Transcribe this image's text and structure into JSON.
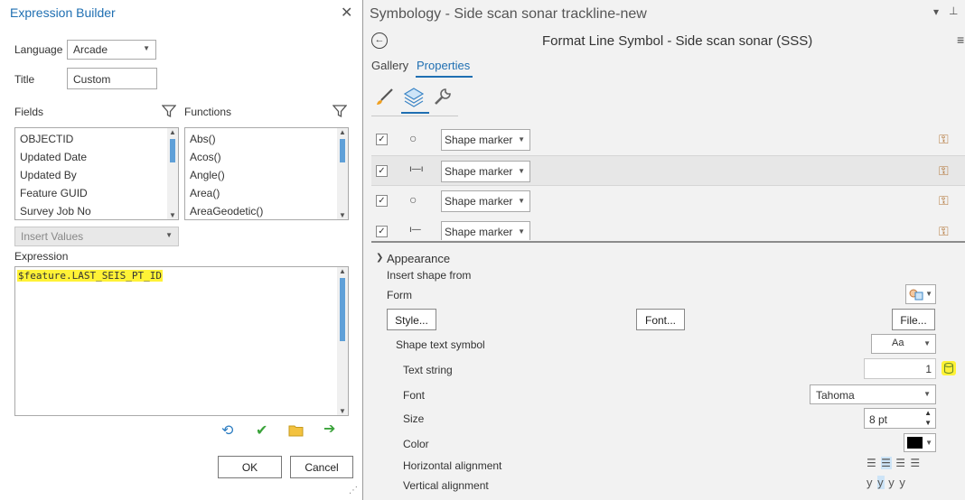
{
  "expression_builder": {
    "title": "Expression Builder",
    "language_label": "Language",
    "language_value": "Arcade",
    "title_label": "Title",
    "title_value": "Custom",
    "fields_label": "Fields",
    "functions_label": "Functions",
    "fields": [
      "OBJECTID",
      "Updated Date",
      "Updated By",
      "Feature GUID",
      "Survey Job No"
    ],
    "functions": [
      "Abs()",
      "Acos()",
      "Angle()",
      "Area()",
      "AreaGeodetic()"
    ],
    "insert_values": "Insert Values",
    "expression_label": "Expression",
    "expression_keyword": "$feature",
    "expression_field": ".LAST_SEIS_PT_ID",
    "ok": "OK",
    "cancel": "Cancel"
  },
  "symbology": {
    "pane_title": "Symbology - Side scan sonar trackline-new",
    "format_title": "Format Line Symbol - Side scan sonar (SSS)",
    "tabs": [
      "Gallery",
      "Properties"
    ],
    "layers": [
      {
        "checked": true,
        "marker": "Shape marker",
        "glyph": "○"
      },
      {
        "checked": true,
        "marker": "Shape marker",
        "glyph": "ı—ı"
      },
      {
        "checked": true,
        "marker": "Shape marker",
        "glyph": "○"
      },
      {
        "checked": true,
        "marker": "Shape marker",
        "glyph": "ı—"
      }
    ],
    "appearance": {
      "heading": "Appearance",
      "insert_shape_from": "Insert shape from",
      "form": "Form",
      "style_btn": "Style...",
      "font_btn": "Font...",
      "file_btn": "File...",
      "shape_text_symbol": "Shape text symbol",
      "shape_text_value": "Aa",
      "text_string_label": "Text string",
      "text_string_value": "1",
      "font_label": "Font",
      "font_value": "Tahoma",
      "size_label": "Size",
      "size_value": "8 pt",
      "color_label": "Color",
      "color_value": "#000000",
      "halign_label": "Horizontal alignment",
      "valign_label": "Vertical alignment"
    }
  }
}
